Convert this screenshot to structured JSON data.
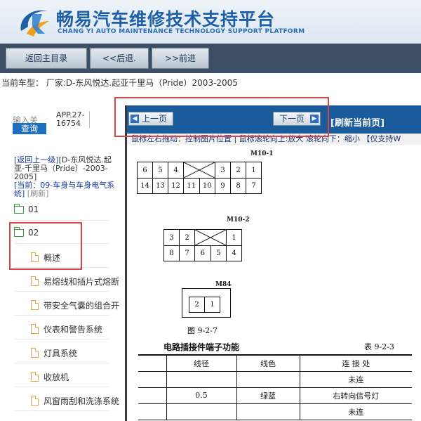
{
  "header": {
    "title": "畅易汽车维修技术支持平台",
    "subtitle": "CHANG YI AUTO MAINTENANCE TECHNOLOGY SUPPORT PLATFORM",
    "brand_color": "#1e5fa8"
  },
  "toolbar": {
    "home_label": "返回主目录",
    "back_label": "<<后退.",
    "forward_label": ">>前进"
  },
  "model_line": "当前车型： 厂家:D-东风悦达.起亚千里马（Pride）2003-2005",
  "left": {
    "search_placeholder": "输入关",
    "search_button": "查询",
    "app_code": "APP.27-16754",
    "crumb_back": "[返回上一级]",
    "crumb_model": "[D-东风悦达.起亚-千里马（Pride）-2003-2005]",
    "crumb_current_prefix": "[当前：",
    "crumb_current": "09-车身与车身电气系统",
    "crumb_current_suffix": "]",
    "crumb_refresh": "[刷新]",
    "tree": [
      {
        "type": "folder",
        "label": "01"
      },
      {
        "type": "folder",
        "label": "02"
      },
      {
        "type": "doc",
        "label": "概述"
      },
      {
        "type": "doc",
        "label": "易熔线和插片式熔断"
      },
      {
        "type": "doc",
        "label": "带安全气囊的组合开"
      },
      {
        "type": "doc",
        "label": "仪表和警告系统"
      },
      {
        "type": "doc",
        "label": "灯具系统"
      },
      {
        "type": "doc",
        "label": "收放机"
      },
      {
        "type": "doc",
        "label": "风窗雨刮和洗涤系统"
      }
    ]
  },
  "viewer": {
    "prev_label": "上一页",
    "next_label": "下一页",
    "refresh_label": "[刷新当前页]",
    "hint": "鼠标左右拖动：控制图片位置 | 鼠标滚轮向上:放大  滚轮向下：缩小 【仅支持W"
  },
  "document": {
    "conn1": {
      "label": "M10-1",
      "row1": [
        "6",
        "5",
        "4",
        "",
        "3",
        "2",
        "1"
      ],
      "row2": [
        "14",
        "13",
        "12",
        "11",
        "10",
        "9",
        "8",
        "7"
      ]
    },
    "conn2": {
      "label": "M10-2",
      "row1": [
        "3",
        "2",
        "",
        "1"
      ],
      "row2": [
        "8",
        "7",
        "6",
        "5",
        "4"
      ]
    },
    "conn3": {
      "label": "M84",
      "pins": [
        "2",
        "1"
      ]
    },
    "figure": "图   9-2-7",
    "table_title": "电路插接件端子功能",
    "table_number": "表 9-2-3",
    "columns": [
      "线径",
      "线色",
      "连 接 处"
    ],
    "rows": [
      [
        "",
        "",
        "未连"
      ],
      [
        "0.5",
        "绿蓝",
        "右转向信号灯"
      ],
      [
        "",
        "",
        "未连"
      ]
    ]
  }
}
